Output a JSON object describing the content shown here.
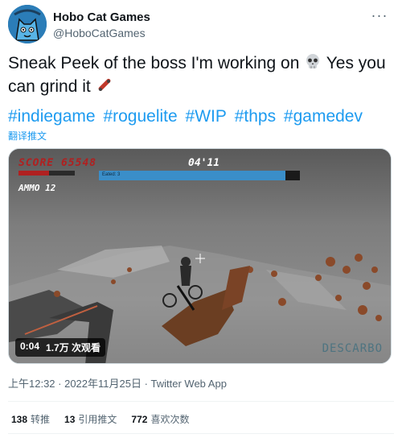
{
  "author": {
    "display_name": "Hobo Cat Games",
    "handle": "@HoboCatGames"
  },
  "more_icon": "ellipsis-icon",
  "tweet": {
    "text_part1": "Sneak Peek of the boss I'm working on ",
    "emoji1": "skull-icon",
    "text_part2": " Yes you can grind it ",
    "emoji2": "skateboard-icon",
    "hashtags": [
      "#indiegame",
      "#roguelite",
      "#WIP",
      "#thps",
      "#gamedev"
    ],
    "translate": "翻译推文"
  },
  "media": {
    "hud_score": "SCORE 65548",
    "hud_timer": "04'11",
    "hud_ammo": "AMMO 12",
    "hud_bar_label": "Eated: 3",
    "watermark": "DESCARBO",
    "time": "0:04",
    "views": "1.7万 次观看"
  },
  "meta": {
    "time": "上午12:32 · 2022年11月25日 · ",
    "app": "Twitter Web App"
  },
  "stats": {
    "retweets_count": "138",
    "retweets_label": "转推",
    "quotes_count": "13",
    "quotes_label": "引用推文",
    "likes_count": "772",
    "likes_label": "喜欢次数"
  },
  "colors": {
    "link": "#1d9bf0",
    "secondary_text": "#536471",
    "hud_score": "#b02020",
    "hud_bar": "#3a8ec9"
  }
}
